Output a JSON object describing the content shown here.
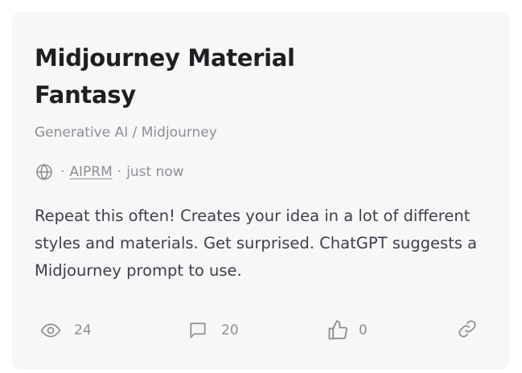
{
  "card": {
    "title": "Midjourney Material Fantasy",
    "category": "Generative AI / Midjourney",
    "meta": {
      "visibility_icon": "globe-icon",
      "separator": "·",
      "author": "AIPRM",
      "time": "just now"
    },
    "description": "Repeat this often! Creates your idea in a lot of different styles and materials. Get surprised. ChatGPT suggests a Midjourney prompt to use.",
    "stats": {
      "views": {
        "icon": "eye-icon",
        "count": "24"
      },
      "comments": {
        "icon": "comment-icon",
        "count": "20"
      },
      "likes": {
        "icon": "thumbs-up-icon",
        "count": "0"
      },
      "link": {
        "icon": "link-icon"
      }
    }
  },
  "colors": {
    "card_background": "#f7f7f8",
    "title": "#1f1f23",
    "text": "#3e3f4b",
    "muted": "#8e8e96"
  }
}
